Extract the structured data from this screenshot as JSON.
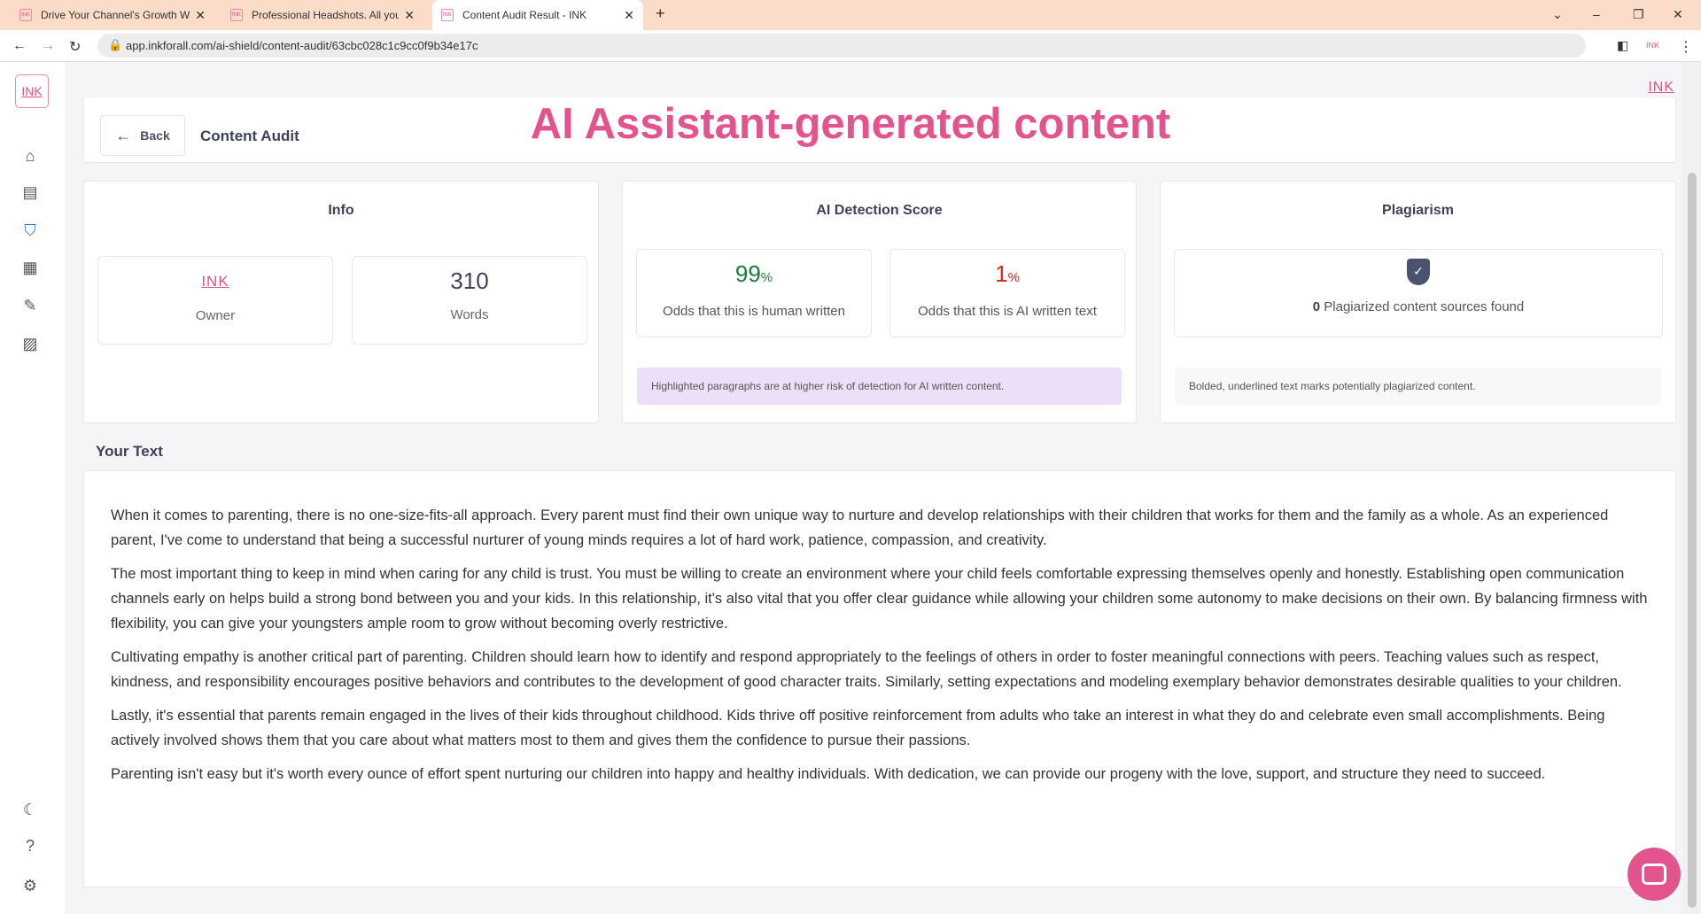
{
  "browser": {
    "tabs": [
      {
        "title": "Drive Your Channel's Growth With"
      },
      {
        "title": "Professional Headshots. All you n"
      },
      {
        "title": "Content Audit Result - INK"
      }
    ],
    "url": "app.inkforall.com/ai-shield/content-audit/63cbc028c1c9cc0f9b34e17c"
  },
  "app": {
    "logo": "INK",
    "brand_right": "INK",
    "accent": "#e3548f"
  },
  "sidebar": {
    "icons": [
      "home-icon",
      "document-icon",
      "shield-icon",
      "calendar-icon",
      "edit-icon",
      "image-icon",
      "moon-icon",
      "help-icon",
      "gear-icon"
    ]
  },
  "header": {
    "back_label": "Back",
    "title": "Content Audit",
    "overlay_title": "AI Assistant-generated content"
  },
  "info": {
    "title": "Info",
    "owner_logo": "INK",
    "owner_label": "Owner",
    "words_value": "310",
    "words_label": "Words"
  },
  "ai": {
    "title": "AI Detection Score",
    "human_value": "99",
    "human_label": "Odds that this is human written",
    "ai_value": "1",
    "ai_label": "Odds that this is AI written text",
    "pct": "%",
    "note": "Highlighted paragraphs are at higher risk of detection for AI written content.",
    "human_color": "#1e7a3c",
    "ai_color": "#e02424"
  },
  "plagiarism": {
    "title": "Plagiarism",
    "count": "0",
    "label": "Plagiarized content sources found",
    "note": "Bolded, underlined text marks potentially plagiarized content."
  },
  "text": {
    "heading": "Your Text",
    "paragraphs": [
      "When it comes to parenting, there is no one-size-fits-all approach. Every parent must find their own unique way to nurture and develop relationships with their children that works for them and the family as a whole. As an experienced parent, I've come to understand that being a successful nurturer of young minds requires a lot of hard work, patience, compassion, and creativity.",
      "The most important thing to keep in mind when caring for any child is trust. You must be willing to create an environment where your child feels comfortable expressing themselves openly and honestly. Establishing open communication channels early on helps build a strong bond between you and your kids. In this relationship, it's also vital that you offer clear guidance while allowing your children some autonomy to make decisions on their own. By balancing firmness with flexibility, you can give your youngsters ample room to grow without becoming overly restrictive.",
      "Cultivating empathy is another critical part of parenting. Children should learn how to identify and respond appropriately to the feelings of others in order to foster meaningful connections with peers. Teaching values such as respect, kindness, and responsibility encourages positive behaviors and contributes to the development of good character traits. Similarly, setting expectations and modeling exemplary behavior demonstrates desirable qualities to your children.",
      "Lastly, it's essential that parents remain engaged in the lives of their kids throughout childhood. Kids thrive off positive reinforcement from adults who take an interest in what they do and celebrate even small accomplishments. Being actively involved shows them that you care about what matters most to them and gives them the confidence to pursue their passions.",
      "Parenting isn't easy but it's worth every ounce of effort spent nurturing our children into happy and healthy individuals. With dedication, we can provide our progeny with the love, support, and structure they need to succeed."
    ]
  }
}
